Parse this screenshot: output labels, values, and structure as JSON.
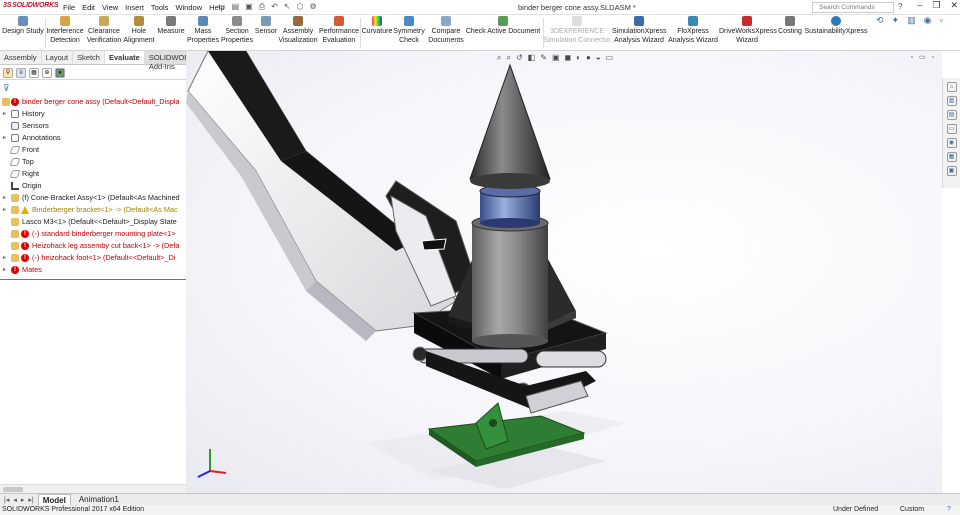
{
  "app": {
    "logo": "SOLIDWORKS",
    "document_title": "binder berger cone assy.SLDASM *"
  },
  "menu": [
    "File",
    "Edit",
    "View",
    "Insert",
    "Tools",
    "Window",
    "Help"
  ],
  "search": {
    "placeholder": "Search Commands"
  },
  "ribbon": [
    {
      "label": "Design Study",
      "icon": "design-study-icon"
    },
    {
      "label": "Interference Detection",
      "icon": "interference-icon"
    },
    {
      "label": "Clearance Verification",
      "icon": "clearance-icon"
    },
    {
      "label": "Hole Alignment",
      "icon": "hole-alignment-icon"
    },
    {
      "label": "Measure",
      "icon": "measure-icon"
    },
    {
      "label": "Mass Properties",
      "icon": "mass-properties-icon"
    },
    {
      "label": "Section Properties",
      "icon": "section-properties-icon"
    },
    {
      "label": "Sensor",
      "icon": "sensor-icon"
    },
    {
      "label": "Assembly Visualization",
      "icon": "assembly-visualization-icon"
    },
    {
      "label": "Performance Evaluation",
      "icon": "performance-icon"
    },
    {
      "label": "Curvature",
      "icon": "curvature-icon"
    },
    {
      "label": "Symmetry Check",
      "icon": "symmetry-icon"
    },
    {
      "label": "Compare Documents",
      "icon": "compare-icon"
    },
    {
      "label": "Check Active Document",
      "icon": "check-document-icon"
    },
    {
      "label": "3DEXPERIENCE Simulation Connector",
      "icon": "3dexperience-icon"
    },
    {
      "label": "SimulationXpress Analysis Wizard",
      "icon": "simulationxpress-icon"
    },
    {
      "label": "FloXpress Analysis Wizard",
      "icon": "floxpress-icon"
    },
    {
      "label": "DriveWorksXpress Wizard",
      "icon": "driveworks-icon"
    },
    {
      "label": "Costing",
      "icon": "costing-icon"
    },
    {
      "label": "SustainabilityXpress",
      "icon": "sustainability-icon"
    }
  ],
  "cm_tabs": [
    "Assembly",
    "Layout",
    "Sketch",
    "Evaluate",
    "SOLIDWORKS Add-Ins"
  ],
  "tree": {
    "root": "binder berger cone assy  (Default<Default_Displa",
    "items": [
      {
        "label": "History",
        "status": "normal"
      },
      {
        "label": "Sensors",
        "status": "normal"
      },
      {
        "label": "Annotations",
        "status": "normal"
      },
      {
        "label": "Front",
        "status": "normal"
      },
      {
        "label": "Top",
        "status": "normal"
      },
      {
        "label": "Right",
        "status": "normal"
      },
      {
        "label": "Origin",
        "status": "normal"
      },
      {
        "label": "(f) Cone-Bracket Assy<1> (Default<As Machined",
        "status": "normal"
      },
      {
        "label": "Binderberger bracket<1> -> (Default<As Mac",
        "status": "warn"
      },
      {
        "label": "Lasco M3<1> (Default<<Default>_Display State",
        "status": "normal"
      },
      {
        "label": "(-) standard binderberger mounting plate<1>",
        "status": "err"
      },
      {
        "label": "Heizohack leg assemby cut back<1> -> (Defa",
        "status": "err"
      },
      {
        "label": "(-) heizohack foot<1> (Default<<Default>_Di",
        "status": "err"
      },
      {
        "label": "Mates",
        "status": "err"
      }
    ]
  },
  "bottom_tabs": [
    "Model",
    "Animation1"
  ],
  "status": {
    "left": "SOLIDWORKS Professional 2017 x64 Edition",
    "state": "Under Defined",
    "units": "Custom",
    "help": "?"
  }
}
